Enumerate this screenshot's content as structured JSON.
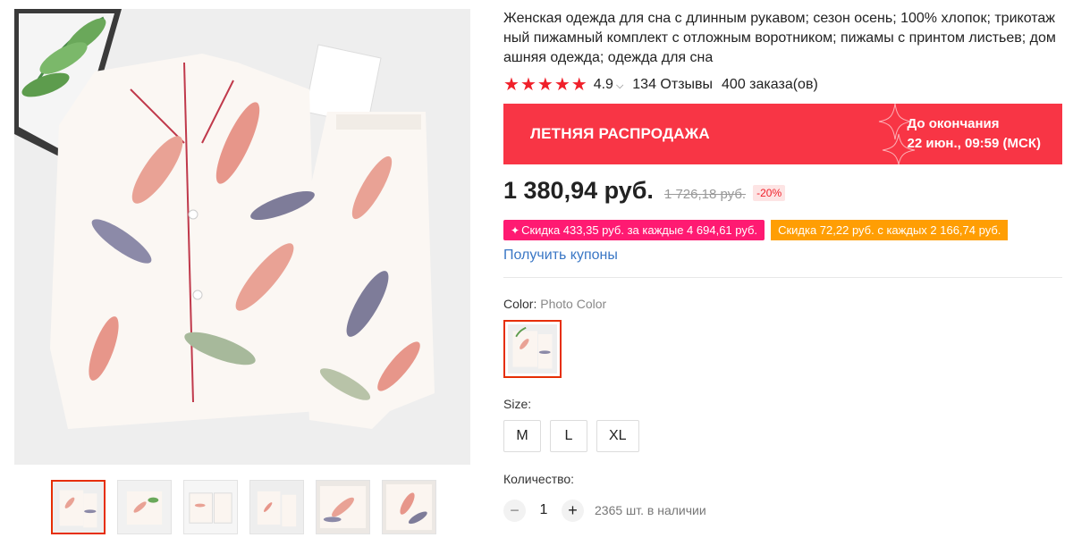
{
  "product": {
    "title": "Женская одежда для сна с длинным рукавом; сезон осень; 100% хлопок; трикотажный пижамный комплект с отложным воротником; пижамы с принтом листьев; домашняя одежда; одежда для сна",
    "rating": "4.9",
    "stars": 5,
    "reviews": "134 Отзывы",
    "orders": "400 заказа(ов)"
  },
  "sale": {
    "title": "ЛЕТНЯЯ РАСПРОДАЖА",
    "timer_label": "До окончания",
    "timer_value": "22 июн., 09:59 (МСК)"
  },
  "price": {
    "current": "1 380,94 руб.",
    "old": "1 726,18 руб.",
    "discount": "-20%"
  },
  "promos": [
    {
      "icon": "sparkle-icon",
      "text": "Скидка 433,35 руб. за каждые 4 694,61 руб."
    },
    {
      "text": "Скидка 72,22 руб. с каждых 2 166,74 руб."
    }
  ],
  "coupons_link": "Получить купоны",
  "color": {
    "label": "Color:",
    "value": "Photo Color"
  },
  "size": {
    "label": "Size:",
    "options": [
      "M",
      "L",
      "XL"
    ]
  },
  "quantity": {
    "label": "Количество:",
    "minus": "−",
    "value": "1",
    "plus": "+",
    "stock": "2365 шт. в наличии"
  },
  "gallery": {
    "thumbnail_count": 6,
    "active_index": 0
  },
  "colors": {
    "accent_red": "#f83545",
    "price_badge": "#fde4e4",
    "promo_pink": "#ff1a72",
    "promo_orange": "#ff9e04",
    "link_blue": "#3a77c5",
    "selected_border": "#e62e04"
  }
}
